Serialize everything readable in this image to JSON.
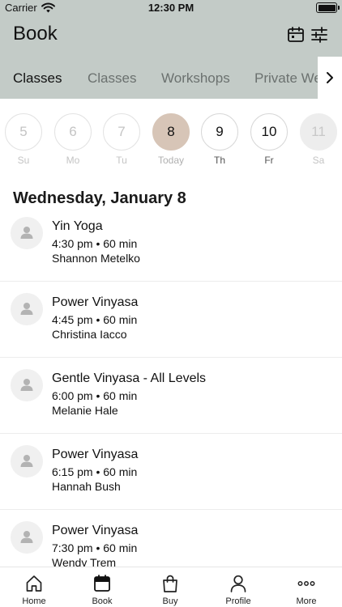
{
  "status_bar": {
    "carrier": "Carrier",
    "time": "12:30 PM"
  },
  "header": {
    "title": "Book",
    "calendar_icon": "calendar-icon",
    "filter_icon": "sliders-icon"
  },
  "tabs": [
    {
      "label": "Classes",
      "active": true
    },
    {
      "label": "Classes",
      "active": false
    },
    {
      "label": "Workshops",
      "active": false
    },
    {
      "label": "Private We",
      "active": false
    }
  ],
  "week": [
    {
      "number": "5",
      "label": "Su",
      "state": "past"
    },
    {
      "number": "6",
      "label": "Mo",
      "state": "past"
    },
    {
      "number": "7",
      "label": "Tu",
      "state": "past"
    },
    {
      "number": "8",
      "label": "Today",
      "state": "selected"
    },
    {
      "number": "9",
      "label": "Th",
      "state": "available"
    },
    {
      "number": "10",
      "label": "Fr",
      "state": "available"
    },
    {
      "number": "11",
      "label": "Sa",
      "state": "faded"
    }
  ],
  "date_heading": "Wednesday, January 8",
  "classes": [
    {
      "name": "Yin Yoga",
      "time": "4:30 pm • 60 min",
      "teacher": "Shannon Metelko"
    },
    {
      "name": "Power Vinyasa",
      "time": "4:45 pm • 60 min",
      "teacher": "Christina Iacco"
    },
    {
      "name": "Gentle Vinyasa - All Levels",
      "time": "6:00 pm • 60 min",
      "teacher": "Melanie Hale"
    },
    {
      "name": "Power Vinyasa",
      "time": "6:15 pm • 60 min",
      "teacher": "Hannah Bush"
    },
    {
      "name": "Power Vinyasa",
      "time": "7:30 pm • 60 min",
      "teacher": "Wendy Trem"
    }
  ],
  "bottom_nav": [
    {
      "label": "Home",
      "icon": "home-icon"
    },
    {
      "label": "Book",
      "icon": "calendar-icon"
    },
    {
      "label": "Buy",
      "icon": "shopping-bag-icon"
    },
    {
      "label": "Profile",
      "icon": "profile-icon"
    },
    {
      "label": "More",
      "icon": "more-icon"
    }
  ],
  "colors": {
    "header_bg": "#c3cbc7",
    "selected_day": "#d7c5b7"
  }
}
